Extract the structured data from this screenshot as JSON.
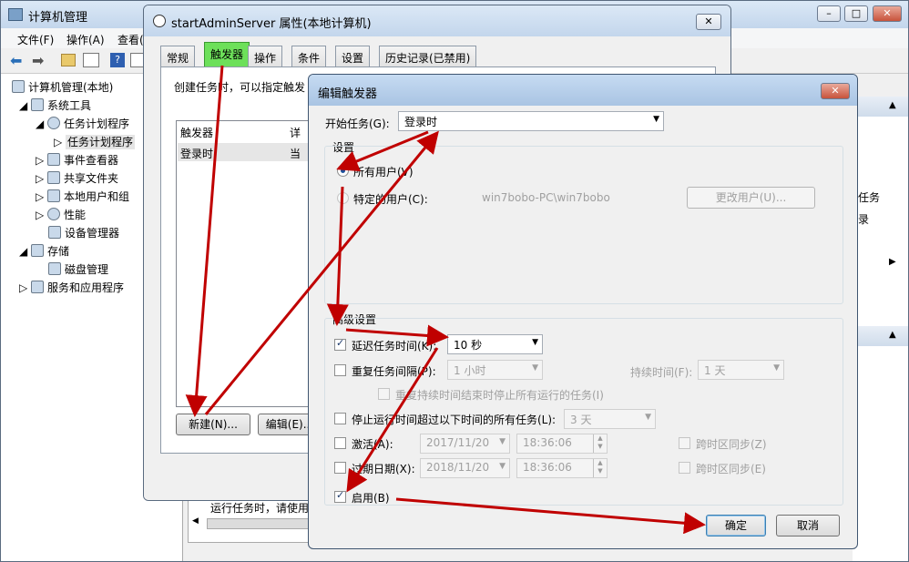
{
  "mmc": {
    "title": "计算机管理",
    "menu": [
      "文件(F)",
      "操作(A)",
      "查看("
    ],
    "tree": [
      {
        "label": "计算机管理(本地)"
      },
      {
        "label": "系统工具"
      },
      {
        "label": "任务计划程序"
      },
      {
        "label": "任务计划程序"
      },
      {
        "label": "事件查看器"
      },
      {
        "label": "共享文件夹"
      },
      {
        "label": "本地用户和组"
      },
      {
        "label": "性能"
      },
      {
        "label": "设备管理器"
      },
      {
        "label": "存储"
      },
      {
        "label": "磁盘管理"
      },
      {
        "label": "服务和应用程序"
      }
    ],
    "right_texts": [
      "任务",
      "录"
    ],
    "bottom_text": "运行任务时，请使用"
  },
  "props": {
    "title": "startAdminServer 属性(本地计算机)",
    "tabs": [
      "常规",
      "触发器",
      "操作",
      "条件",
      "设置",
      "历史记录(已禁用)"
    ],
    "intro": "创建任务时，可以指定触发",
    "col_trigger": "触发器",
    "col_detail": "详",
    "row_trigger": "登录时",
    "row_detail": "当",
    "new_btn": "新建(N)...",
    "edit_btn": "编辑(E)..."
  },
  "dialog": {
    "title": "编辑触发器",
    "start_label": "开始任务(G):",
    "start_value": "登录时",
    "settings_label": "设置",
    "all_users": "所有用户(V)",
    "specific_user": "特定的用户(C):",
    "user_name": "win7bobo-PC\\win7bobo",
    "change_user": "更改用户(U)...",
    "advanced_label": "高级设置",
    "delay_label": "延迟任务时间(K):",
    "delay_value": "10 秒",
    "repeat_label": "重复任务间隔(P):",
    "repeat_value": "1 小时",
    "duration_label": "持续时间(F):",
    "duration_value": "1 天",
    "stop_at_end": "重复持续时间结束时停止所有运行的任务(I)",
    "stop_longer": "停止运行时间超过以下时间的所有任务(L):",
    "stop_value": "3 天",
    "activate_label": "激活(A):",
    "activate_date": "2017/11/20",
    "activate_time": "18:36:06",
    "expire_label": "过期日期(X):",
    "expire_date": "2018/11/20",
    "expire_time": "18:36:06",
    "sync1": "跨时区同步(Z)",
    "sync2": "跨时区同步(E)",
    "enabled_label": "启用(B)",
    "ok": "确定",
    "cancel": "取消"
  },
  "colors": {
    "arrow": "#c00000",
    "titlebar": "#c3d6ec"
  }
}
